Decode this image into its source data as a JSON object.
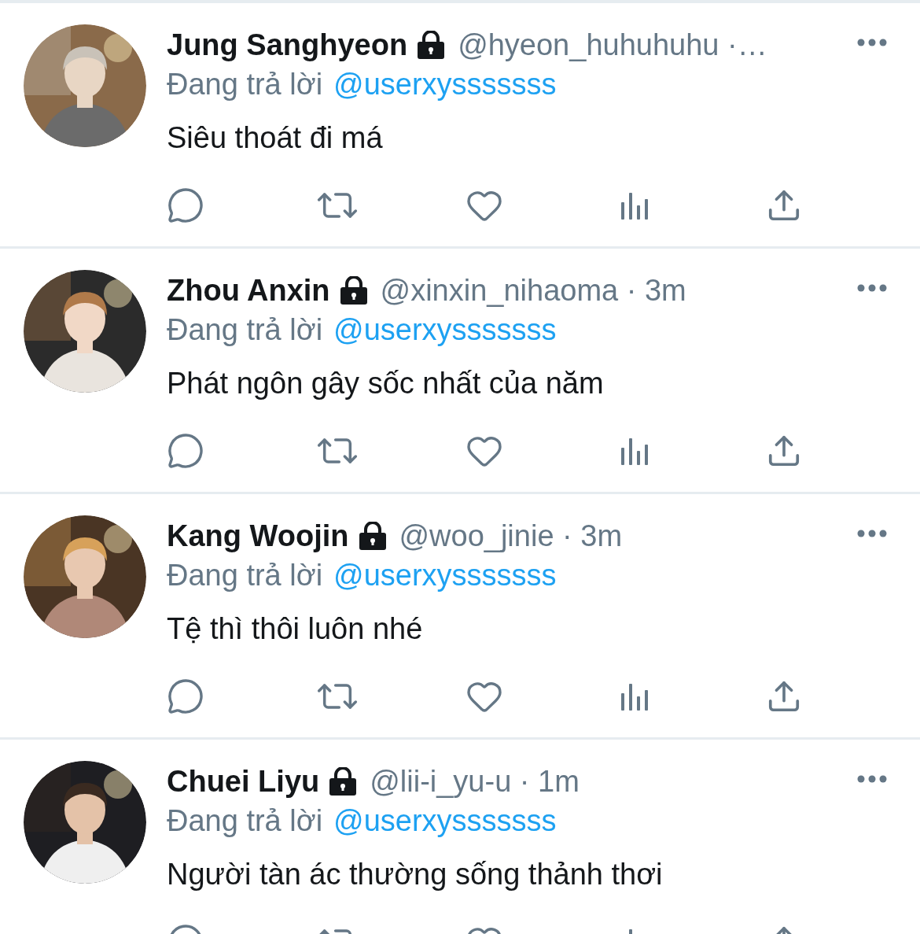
{
  "tweets": [
    {
      "name": "Jung Sanghyeon",
      "meta": "@hyeon_huhuhuhu ·…",
      "reply_prefix": "Đang trả lời",
      "reply_to": "@userxysssssss",
      "text": "Siêu thoát đi má"
    },
    {
      "name": "Zhou Anxin",
      "meta": "@xinxin_nihaoma · 3m",
      "reply_prefix": "Đang trả lời",
      "reply_to": "@userxysssssss",
      "text": "Phát ngôn gây sốc nhất của năm"
    },
    {
      "name": "Kang Woojin",
      "meta": "@woo_jinie · 3m",
      "reply_prefix": "Đang trả lời",
      "reply_to": "@userxysssssss",
      "text": "Tệ thì thôi luôn nhé"
    },
    {
      "name": "Chuei Liyu",
      "meta": "@lii-i_yu-u · 1m",
      "reply_prefix": "Đang trả lời",
      "reply_to": "@userxysssssss",
      "text": "Người tàn ác thường sống thảnh thơi"
    }
  ]
}
